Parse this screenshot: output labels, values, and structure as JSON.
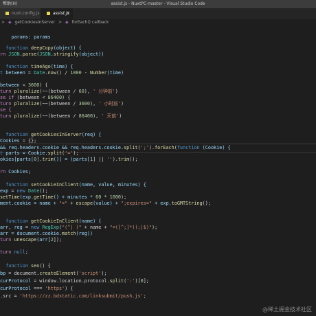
{
  "window": {
    "menu": "帮助(H)",
    "title": "assist.js - NuxtPC-master - Visual Studio Code"
  },
  "tabs": [
    {
      "label": "nuxt.config.js",
      "active": false
    },
    {
      "label": "assist.js",
      "active": true
    }
  ],
  "tab_close": "×",
  "breadcrumb": [
    "getCookiesInServer",
    "forEach() callback"
  ],
  "breadcrumb_sep": ">",
  "code": {
    "l01": [
      "params: params"
    ],
    "l02": [
      "function",
      "deepCopy",
      "(object) {"
    ],
    "l03": [
      "rn ",
      "JSON",
      ".",
      "parse",
      "(",
      "JSON",
      ".",
      "stringify",
      "(object))"
    ],
    "l04": [
      "function",
      "timeAgo",
      "(time) {"
    ],
    "l05": [
      "t ",
      "between",
      " = ",
      "Date",
      ".",
      "now",
      "() / ",
      "1000",
      " - ",
      "Number",
      "(time)"
    ],
    "l06": [
      "between",
      " < ",
      "3600",
      ") {"
    ],
    "l07": [
      "turn ",
      "pluralize",
      "(~~(between / ",
      "60",
      "), ",
      "' 分钟前'",
      ")"
    ],
    "l08": [
      "se if",
      " (between < ",
      "86400",
      ") {"
    ],
    "l09": [
      "turn ",
      "pluralize",
      "(~~(between / ",
      "3600",
      "), ",
      "' 小时前'",
      ")"
    ],
    "l10": [
      "se {"
    ],
    "l11": [
      "turn ",
      "pluralize",
      "(~~(between / ",
      "86400",
      "), ",
      "' 天前'",
      ")"
    ],
    "l12": [
      "function",
      "getCookiesInServer",
      "(req) {"
    ],
    "l13": [
      "Cookies",
      " = {};"
    ],
    "l14": [
      "&& req.headers.cookie && req.headers.cookie.",
      "split",
      "(",
      "';'",
      ").",
      "forEach",
      "(",
      "function",
      " (Cookie) {"
    ],
    "l15": [
      "t ",
      "parts",
      " = Cookie.",
      "split",
      "(",
      "'='",
      ");"
    ],
    "l16": [
      "okies[parts[",
      "0",
      "].",
      "trim",
      "()] = (parts[",
      "1",
      "] || ",
      "''",
      ").",
      "trim",
      "();"
    ],
    "l17": [
      "rn ",
      "Cookies",
      ";"
    ],
    "l18": [
      "function",
      "setCookieInClient",
      "(name, value, minutes) {"
    ],
    "l19": [
      "exp",
      " = ",
      "new",
      " ",
      "Date",
      "();"
    ],
    "l20": [
      "setTime",
      "(exp.",
      "getTime",
      "() + minutes * ",
      "60",
      " * ",
      "1000",
      ");"
    ],
    "l21": [
      "ment.cookie = name + ",
      "\"=\"",
      " + ",
      "escape",
      "(value) + ",
      "\";expires=\"",
      " + exp.",
      "toGMTString",
      "();"
    ],
    "l22": [
      "function",
      "getCookieInClient",
      "(name) {"
    ],
    "l23": [
      "arr",
      ", ",
      "reg",
      " = ",
      "new",
      " ",
      "RegExp",
      "(",
      "\"(^| )\"",
      " + name + ",
      "\"=([^;]*)(;|$)\"",
      ");"
    ],
    "l24": [
      "arr",
      " = document.cookie.",
      "match",
      "(reg))"
    ],
    "l25": [
      "turn ",
      "unescape",
      "(arr[",
      "2",
      "]);"
    ],
    "l26": [
      "turn ",
      "null",
      ";"
    ],
    "l27": [
      "function",
      "seo",
      "() {"
    ],
    "l28": [
      "bp",
      " = document.",
      "createElement",
      "(",
      "'script'",
      ");"
    ],
    "l29": [
      "curProtocol",
      " = window.location.protocol.",
      "split",
      "(",
      "':'",
      ")[",
      "0",
      "];"
    ],
    "l30": [
      "curProtocol",
      " === ",
      "'https'",
      ") {"
    ],
    "l31": [
      ".src = ",
      "'https://zz.bdstatic.com/linksubmit/push.js'",
      ";"
    ]
  },
  "watermark": "@稀土掘金技术社区",
  "colors": {
    "background": "#1e1e1e",
    "keyword": "#569cd6",
    "function": "#dcdcaa",
    "string": "#ce9178",
    "number": "#b5cea8",
    "variable": "#9cdcfe"
  }
}
